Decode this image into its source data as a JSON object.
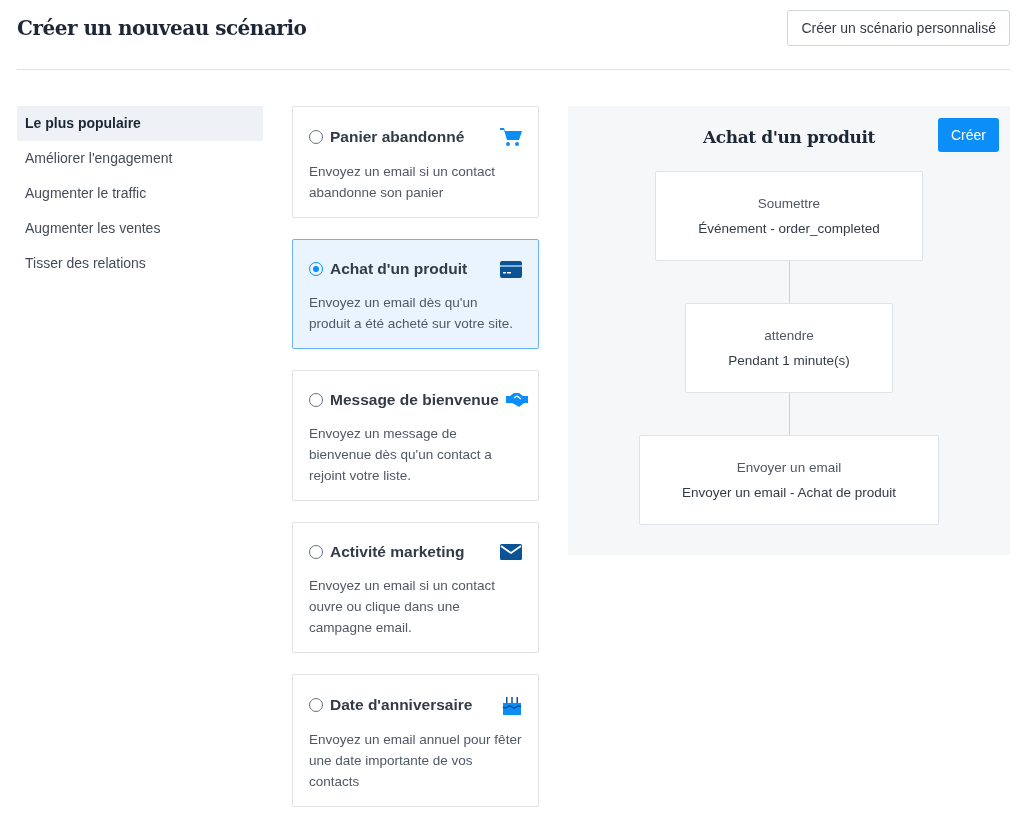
{
  "header": {
    "title": "Créer un nouveau scénario",
    "custom_button": "Créer un scénario personnalisé"
  },
  "sidebar": {
    "items": [
      {
        "label": "Le plus populaire",
        "selected": true
      },
      {
        "label": "Améliorer l'engagement",
        "selected": false
      },
      {
        "label": "Augmenter le traffic",
        "selected": false
      },
      {
        "label": "Augmenter les ventes",
        "selected": false
      },
      {
        "label": "Tisser des relations",
        "selected": false
      }
    ]
  },
  "scenarios": [
    {
      "kind": "cart",
      "title": "Panier abandonné",
      "description": "Envoyez un email si un contact abandonne son panier",
      "selected": false
    },
    {
      "kind": "card",
      "title": "Achat d'un produit",
      "description": "Envoyez un email dès qu'un produit a été acheté sur votre site.",
      "selected": true
    },
    {
      "kind": "handshake",
      "title": "Message de bienvenue",
      "description": "Envoyez un message de bienvenue dès qu'un contact a rejoint votre liste.",
      "selected": false
    },
    {
      "kind": "envelope",
      "title": "Activité marketing",
      "description": "Envoyez un email si un contact ouvre ou clique dans une campagne email.",
      "selected": false
    },
    {
      "kind": "cake",
      "title": "Date d'anniversaire",
      "description": "Envoyez un email annuel pour fêter une date importante de vos contacts",
      "selected": false
    }
  ],
  "preview": {
    "title": "Achat d'un produit",
    "create_button": "Créer",
    "steps": [
      {
        "label": "Soumettre",
        "detail": "Événement - order_completed"
      },
      {
        "label": "attendre",
        "detail": "Pendant 1 minute(s)"
      },
      {
        "label": "Envoyer un email",
        "detail": "Envoyer un email - Achat de produit"
      }
    ]
  }
}
